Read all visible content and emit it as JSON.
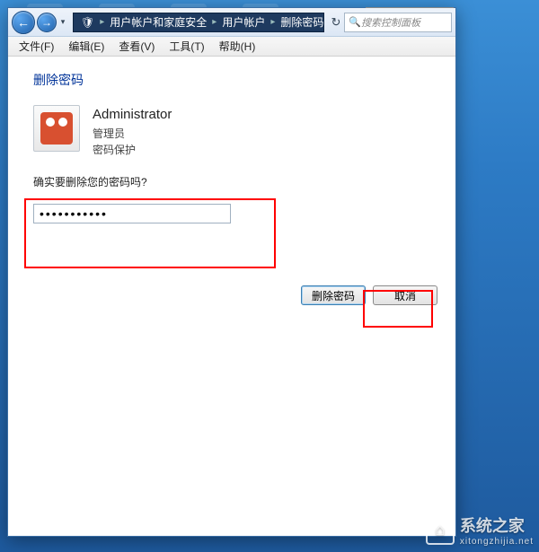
{
  "titlebar": {
    "min_icon": "–",
    "max_icon": "▭",
    "close_icon": "✕"
  },
  "nav": {
    "back_icon": "←",
    "fwd_icon": "→",
    "drop_icon": "▾",
    "refresh_icon": "↻"
  },
  "breadcrumb": {
    "sep": "▸",
    "items": [
      "用户帐户和家庭安全",
      "用户帐户",
      "删除密码"
    ]
  },
  "search": {
    "placeholder": "搜索控制面板",
    "icon": "🔍"
  },
  "menubar": {
    "items": [
      "文件(F)",
      "编辑(E)",
      "查看(V)",
      "工具(T)",
      "帮助(H)"
    ]
  },
  "page": {
    "title": "删除密码"
  },
  "user": {
    "name": "Administrator",
    "role": "管理员",
    "pw_status": "密码保护"
  },
  "prompt": {
    "text": "确实要删除您的密码吗?",
    "password_value": "●●●●●●●●●●●"
  },
  "buttons": {
    "primary": "删除密码",
    "cancel": "取消"
  },
  "watermark": {
    "logo_icon": "⌂",
    "text": "系统之家",
    "url": "xitongzhijia.net"
  }
}
